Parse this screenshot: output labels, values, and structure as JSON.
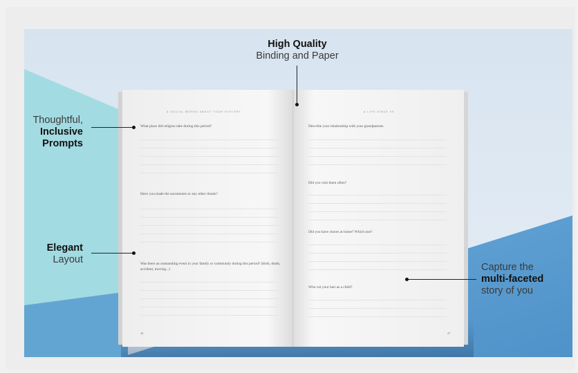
{
  "callouts": {
    "top": {
      "bold": "High Quality",
      "normal": "Binding and Paper"
    },
    "prompts": {
      "line1": "Thoughtful,",
      "bold1": "Inclusive",
      "bold2": "Prompts"
    },
    "layout": {
      "bold": "Elegant",
      "normal": "Layout"
    },
    "story": {
      "line1": "Capture the",
      "bold": "multi-faceted",
      "line3": "story of you"
    }
  },
  "book": {
    "left_header": "A SOCIAL WORKS ABOUT YOUR HISTORY",
    "right_header": "A LIFE SINCE 99",
    "left_page_number": "46",
    "right_page_number": "47",
    "left_prompts": [
      "What place did religion take during this period?",
      "Have you made the sacraments or any other rituals?",
      "Was there an outstanding event in your family or community during this period? (birth, death, accident, moving...)"
    ],
    "right_prompts": [
      "Describe your relationship with your grandparents",
      "Did you visit them often?",
      "Did you have chores at home? Which one?",
      "Who cut your hair as a child?"
    ]
  },
  "colors": {
    "background_top": "#dbe6f1",
    "teal_panel": "#a3dbe2",
    "blue_panel": "#5e9fd2",
    "page": "#f6f6f6"
  }
}
